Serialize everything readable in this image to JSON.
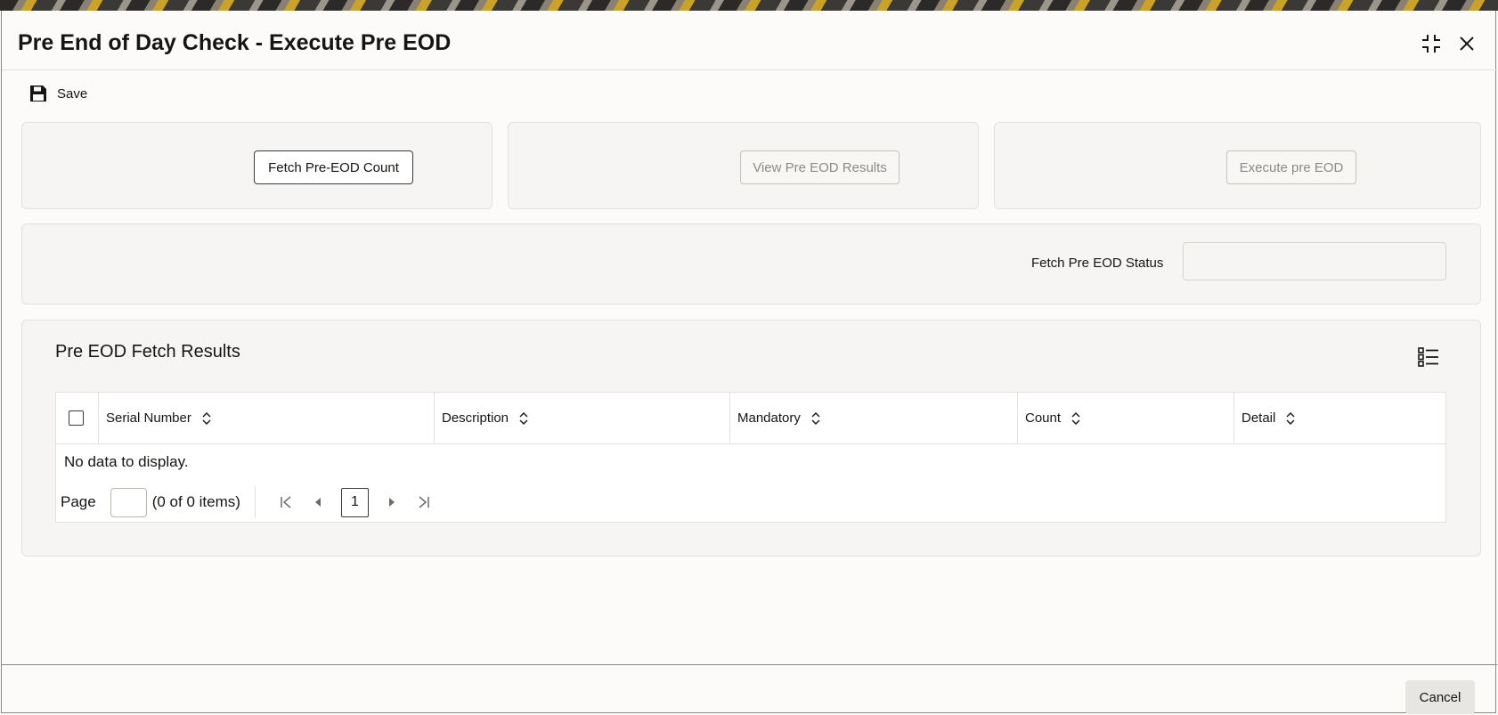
{
  "window": {
    "title": "Pre End of Day Check - Execute Pre EOD",
    "minimize_icon": "collapse-icon",
    "close_icon": "close-icon"
  },
  "toolbar": {
    "save_label": "Save",
    "save_icon": "save-icon"
  },
  "actions": {
    "fetch_label": "Fetch Pre-EOD Count",
    "view_label": "View Pre EOD Results",
    "execute_label": "Execute pre EOD"
  },
  "status": {
    "label": "Fetch Pre EOD Status",
    "value": ""
  },
  "results": {
    "title": "Pre EOD Fetch Results",
    "columns": [
      "Serial Number",
      "Description",
      "Mandatory",
      "Count",
      "Detail"
    ],
    "empty_text": "No data to display.",
    "pager": {
      "page_label": "Page",
      "page_value": "",
      "items_text": "(0 of 0 items)",
      "current_page": "1"
    }
  },
  "footer": {
    "cancel_label": "Cancel"
  },
  "colors": {
    "border": "#e4e1dc",
    "panel": "#f6f5f3",
    "text": "#161513"
  }
}
